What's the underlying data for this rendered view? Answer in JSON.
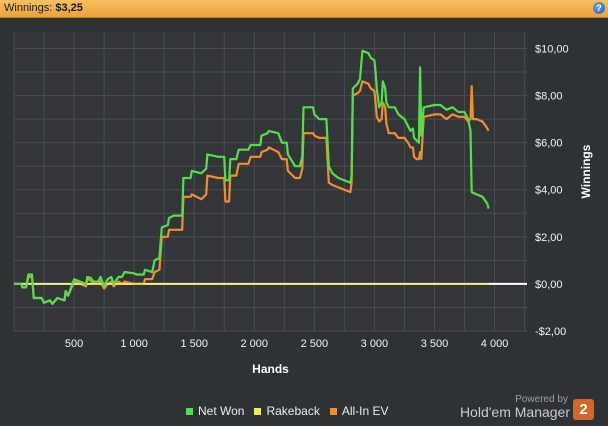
{
  "header": {
    "label": "Winnings:",
    "value": "$3,25"
  },
  "help_icon": "?",
  "colors": {
    "net_won": "#52e04a",
    "rakeback": "#eded60",
    "all_in_ev": "#ef8f30",
    "zero_line": "#ffffff",
    "grid": "#4a4d51",
    "plot_bg": "#333539"
  },
  "chart_data": {
    "type": "line",
    "title": "",
    "xlabel": "Hands",
    "ylabel": "Winnings",
    "xlim": [
      0,
      4270
    ],
    "ylim": [
      -2,
      10.7
    ],
    "x_ticks": [
      500,
      1000,
      1500,
      2000,
      2500,
      3000,
      3500,
      4000
    ],
    "x_tick_labels": [
      "500",
      "1 000",
      "1 500",
      "2 000",
      "2 500",
      "3 000",
      "3 500",
      "4 000"
    ],
    "y_ticks": [
      -2,
      0,
      2,
      4,
      6,
      8,
      10
    ],
    "y_tick_labels": [
      "-$2,00",
      "$0,00",
      "$2,00",
      "$4,00",
      "$6,00",
      "$8,00",
      "$10,00"
    ],
    "grid": true,
    "legend_position": "bottom",
    "series": [
      {
        "name": "Net Won",
        "color": "#52e04a",
        "points": [
          [
            0,
            0
          ],
          [
            60,
            0
          ],
          [
            70,
            -0.15
          ],
          [
            100,
            -0.15
          ],
          [
            120,
            0.4
          ],
          [
            150,
            0.4
          ],
          [
            165,
            -0.6
          ],
          [
            230,
            -0.6
          ],
          [
            250,
            -0.8
          ],
          [
            300,
            -0.7
          ],
          [
            320,
            -0.85
          ],
          [
            360,
            -0.6
          ],
          [
            420,
            -0.7
          ],
          [
            430,
            -0.3
          ],
          [
            450,
            -0.5
          ],
          [
            500,
            0.2
          ],
          [
            550,
            0.1
          ],
          [
            600,
            0.0
          ],
          [
            610,
            0.3
          ],
          [
            640,
            0.25
          ],
          [
            660,
            0.1
          ],
          [
            700,
            0.1
          ],
          [
            720,
            0.3
          ],
          [
            750,
            -0.1
          ],
          [
            780,
            0.2
          ],
          [
            810,
            0.3
          ],
          [
            830,
            0.0
          ],
          [
            870,
            0.3
          ],
          [
            900,
            0.3
          ],
          [
            920,
            0.5
          ],
          [
            1000,
            0.45
          ],
          [
            1020,
            0.4
          ],
          [
            1080,
            0.4
          ],
          [
            1090,
            0.6
          ],
          [
            1150,
            0.5
          ],
          [
            1170,
            1.0
          ],
          [
            1210,
            1.1
          ],
          [
            1230,
            2.4
          ],
          [
            1280,
            2.5
          ],
          [
            1290,
            2.8
          ],
          [
            1330,
            2.9
          ],
          [
            1400,
            2.9
          ],
          [
            1410,
            4.5
          ],
          [
            1470,
            4.5
          ],
          [
            1480,
            4.8
          ],
          [
            1560,
            4.7
          ],
          [
            1600,
            4.9
          ],
          [
            1610,
            5.5
          ],
          [
            1700,
            5.4
          ],
          [
            1750,
            5.4
          ],
          [
            1760,
            4.4
          ],
          [
            1790,
            4.4
          ],
          [
            1800,
            5.3
          ],
          [
            1850,
            5.3
          ],
          [
            1870,
            5.7
          ],
          [
            1950,
            5.7
          ],
          [
            1970,
            5.9
          ],
          [
            2050,
            5.9
          ],
          [
            2060,
            6.3
          ],
          [
            2110,
            6.4
          ],
          [
            2120,
            6.5
          ],
          [
            2200,
            6.4
          ],
          [
            2230,
            6.0
          ],
          [
            2270,
            6.0
          ],
          [
            2280,
            5.5
          ],
          [
            2340,
            5.0
          ],
          [
            2380,
            5.0
          ],
          [
            2400,
            5.4
          ],
          [
            2410,
            7.5
          ],
          [
            2490,
            7.5
          ],
          [
            2500,
            7.2
          ],
          [
            2540,
            7.0
          ],
          [
            2600,
            7.0
          ],
          [
            2620,
            5.0
          ],
          [
            2650,
            4.7
          ],
          [
            2700,
            4.5
          ],
          [
            2800,
            4.3
          ],
          [
            2810,
            4.6
          ],
          [
            2820,
            8.3
          ],
          [
            2860,
            8.5
          ],
          [
            2880,
            8.7
          ],
          [
            2900,
            9.9
          ],
          [
            2950,
            9.8
          ],
          [
            2970,
            9.6
          ],
          [
            3000,
            9.5
          ],
          [
            3010,
            9.0
          ],
          [
            3020,
            8.3
          ],
          [
            3040,
            7.5
          ],
          [
            3060,
            7.7
          ],
          [
            3070,
            8.6
          ],
          [
            3090,
            8.3
          ],
          [
            3100,
            7.7
          ],
          [
            3120,
            7.5
          ],
          [
            3170,
            7.5
          ],
          [
            3200,
            7.2
          ],
          [
            3250,
            7.0
          ],
          [
            3280,
            6.7
          ],
          [
            3300,
            6.5
          ],
          [
            3320,
            6.6
          ],
          [
            3330,
            6.2
          ],
          [
            3350,
            6.1
          ],
          [
            3370,
            6.0
          ],
          [
            3380,
            9.2
          ],
          [
            3390,
            6.3
          ],
          [
            3410,
            7.5
          ],
          [
            3500,
            7.6
          ],
          [
            3550,
            7.6
          ],
          [
            3600,
            7.4
          ],
          [
            3650,
            7.5
          ],
          [
            3700,
            7.3
          ],
          [
            3750,
            7.3
          ],
          [
            3780,
            7.0
          ],
          [
            3800,
            6.5
          ],
          [
            3810,
            3.9
          ],
          [
            3850,
            3.8
          ],
          [
            3900,
            3.7
          ],
          [
            3940,
            3.4
          ],
          [
            3950,
            3.2
          ]
        ]
      },
      {
        "name": "Rakeback",
        "color": "#eded60",
        "points": [
          [
            0,
            0
          ],
          [
            3950,
            0
          ]
        ]
      },
      {
        "name": "All-In EV",
        "color": "#ef8f30",
        "points": [
          [
            0,
            0
          ],
          [
            60,
            0
          ],
          [
            70,
            -0.15
          ],
          [
            100,
            -0.15
          ],
          [
            120,
            0.3
          ],
          [
            150,
            0.3
          ],
          [
            165,
            -0.6
          ],
          [
            230,
            -0.6
          ],
          [
            250,
            -0.8
          ],
          [
            300,
            -0.7
          ],
          [
            320,
            -0.85
          ],
          [
            360,
            -0.6
          ],
          [
            420,
            -0.7
          ],
          [
            430,
            -0.3
          ],
          [
            450,
            -0.5
          ],
          [
            500,
            0.1
          ],
          [
            550,
            0.0
          ],
          [
            600,
            -0.1
          ],
          [
            610,
            0.2
          ],
          [
            640,
            0.15
          ],
          [
            660,
            0.0
          ],
          [
            700,
            0.0
          ],
          [
            720,
            0.1
          ],
          [
            750,
            -0.2
          ],
          [
            780,
            0.0
          ],
          [
            810,
            0.1
          ],
          [
            830,
            -0.1
          ],
          [
            870,
            0.1
          ],
          [
            900,
            0.0
          ],
          [
            920,
            0.1
          ],
          [
            1000,
            0.0
          ],
          [
            1020,
            0.0
          ],
          [
            1080,
            0.0
          ],
          [
            1090,
            0.2
          ],
          [
            1150,
            0.2
          ],
          [
            1170,
            0.5
          ],
          [
            1210,
            0.6
          ],
          [
            1230,
            2.0
          ],
          [
            1280,
            2.0
          ],
          [
            1290,
            2.3
          ],
          [
            1330,
            2.3
          ],
          [
            1400,
            2.3
          ],
          [
            1410,
            3.7
          ],
          [
            1470,
            3.7
          ],
          [
            1480,
            3.8
          ],
          [
            1560,
            3.6
          ],
          [
            1600,
            3.8
          ],
          [
            1610,
            4.6
          ],
          [
            1700,
            4.5
          ],
          [
            1750,
            4.5
          ],
          [
            1760,
            3.5
          ],
          [
            1790,
            3.5
          ],
          [
            1800,
            4.6
          ],
          [
            1850,
            4.6
          ],
          [
            1870,
            5.1
          ],
          [
            1950,
            5.1
          ],
          [
            1970,
            5.4
          ],
          [
            2050,
            5.4
          ],
          [
            2060,
            5.6
          ],
          [
            2110,
            5.7
          ],
          [
            2120,
            5.8
          ],
          [
            2200,
            5.6
          ],
          [
            2230,
            5.3
          ],
          [
            2270,
            5.3
          ],
          [
            2280,
            4.8
          ],
          [
            2340,
            4.5
          ],
          [
            2380,
            4.5
          ],
          [
            2400,
            4.9
          ],
          [
            2410,
            6.4
          ],
          [
            2490,
            6.4
          ],
          [
            2500,
            6.3
          ],
          [
            2540,
            6.2
          ],
          [
            2600,
            6.2
          ],
          [
            2620,
            4.3
          ],
          [
            2650,
            4.2
          ],
          [
            2700,
            4.1
          ],
          [
            2800,
            3.9
          ],
          [
            2810,
            4.3
          ],
          [
            2820,
            8.0
          ],
          [
            2860,
            8.1
          ],
          [
            2880,
            8.2
          ],
          [
            2900,
            8.6
          ],
          [
            2950,
            8.5
          ],
          [
            2970,
            8.3
          ],
          [
            3000,
            8.2
          ],
          [
            3010,
            7.7
          ],
          [
            3020,
            7.1
          ],
          [
            3040,
            6.9
          ],
          [
            3060,
            7.0
          ],
          [
            3070,
            7.7
          ],
          [
            3090,
            7.5
          ],
          [
            3100,
            6.8
          ],
          [
            3120,
            6.4
          ],
          [
            3170,
            6.4
          ],
          [
            3200,
            6.2
          ],
          [
            3250,
            6.2
          ],
          [
            3280,
            6.0
          ],
          [
            3300,
            5.8
          ],
          [
            3320,
            5.8
          ],
          [
            3330,
            5.4
          ],
          [
            3350,
            5.3
          ],
          [
            3370,
            5.3
          ],
          [
            3380,
            5.6
          ],
          [
            3390,
            5.3
          ],
          [
            3410,
            7.1
          ],
          [
            3500,
            7.2
          ],
          [
            3550,
            7.2
          ],
          [
            3600,
            7.0
          ],
          [
            3650,
            7.2
          ],
          [
            3700,
            7.1
          ],
          [
            3750,
            7.1
          ],
          [
            3780,
            6.9
          ],
          [
            3800,
            7.0
          ],
          [
            3810,
            8.4
          ],
          [
            3820,
            7.0
          ],
          [
            3850,
            7.0
          ],
          [
            3900,
            6.9
          ],
          [
            3940,
            6.6
          ],
          [
            3950,
            6.5
          ]
        ]
      }
    ]
  }
}
